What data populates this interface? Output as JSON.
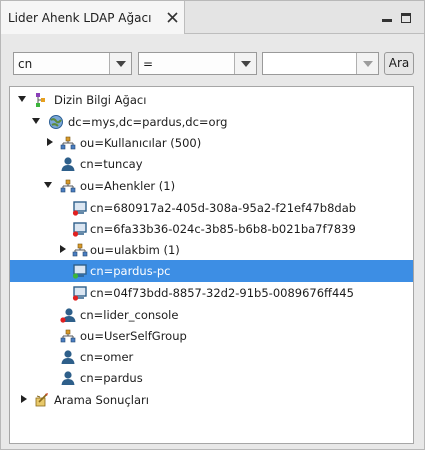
{
  "view": {
    "title": "Lider Ahenk LDAP Ağacı"
  },
  "search": {
    "attribute_value": "cn",
    "operator_value": "=",
    "value_field": "",
    "button_label": "Ara"
  },
  "tree": {
    "nodes": [
      {
        "label": "Dizin Bilgi Ağacı",
        "icon": "tree-root-icon",
        "expander": "open"
      },
      {
        "label": "dc=mys,dc=pardus,dc=org",
        "icon": "globe-icon",
        "expander": "open"
      },
      {
        "label": "ou=Kullanıcılar (500)",
        "icon": "org-unit-icon",
        "expander": "closed"
      },
      {
        "label": "cn=tuncay",
        "icon": "user-icon",
        "expander": "none"
      },
      {
        "label": "ou=Ahenkler (1)",
        "icon": "org-unit-icon",
        "expander": "open"
      },
      {
        "label": "cn=680917a2-405d-308a-95a2-f21ef47b8dab",
        "icon": "computer-offline-icon",
        "expander": "none"
      },
      {
        "label": "cn=6fa33b36-024c-3b85-b6b8-b021ba7f7839",
        "icon": "computer-offline-icon",
        "expander": "none"
      },
      {
        "label": "ou=ulakbim (1)",
        "icon": "org-unit-icon",
        "expander": "closed"
      },
      {
        "label": "cn=pardus-pc",
        "icon": "computer-online-icon",
        "expander": "none",
        "selected": true
      },
      {
        "label": "cn=04f73bdd-8857-32d2-91b5-0089676ff445",
        "icon": "computer-offline-icon",
        "expander": "none"
      },
      {
        "label": "cn=lider_console",
        "icon": "user-offline-icon",
        "expander": "none"
      },
      {
        "label": "ou=UserSelfGroup",
        "icon": "org-unit-icon",
        "expander": "none"
      },
      {
        "label": "cn=omer",
        "icon": "user-icon",
        "expander": "none"
      },
      {
        "label": "cn=pardus",
        "icon": "user-icon",
        "expander": "none"
      },
      {
        "label": "Arama Sonuçları",
        "icon": "search-results-icon",
        "expander": "closed"
      }
    ]
  },
  "colors": {
    "selection": "#3d8ee4",
    "status_online": "#3cb43c",
    "status_offline": "#e02020",
    "user_icon": "#2e5f8a"
  }
}
